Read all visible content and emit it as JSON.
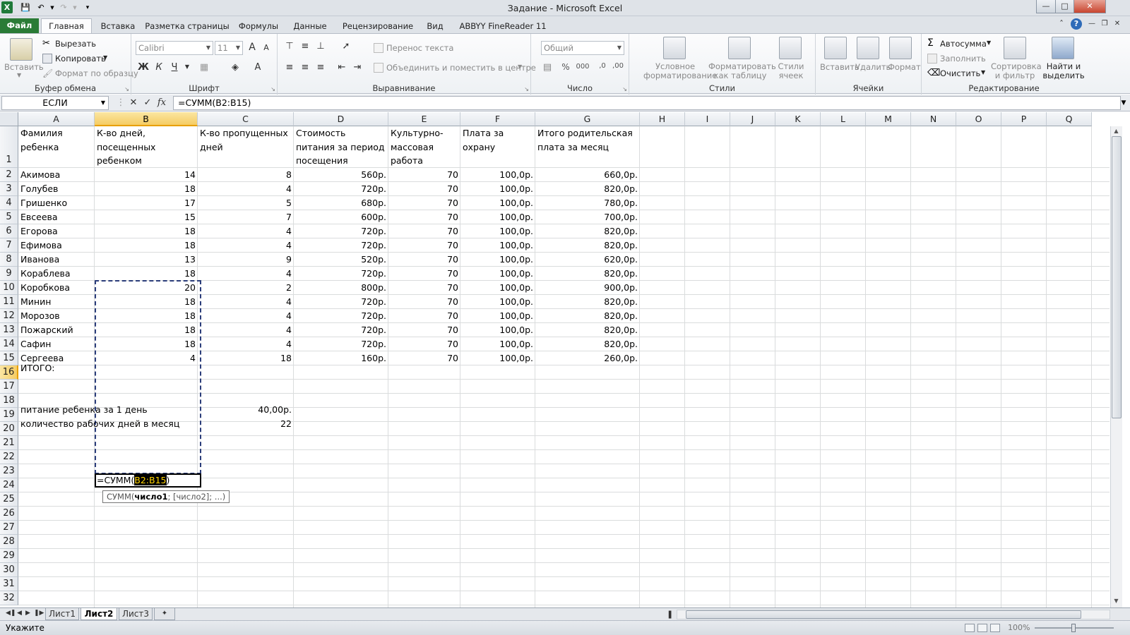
{
  "window": {
    "title": "Задание - Microsoft Excel"
  },
  "ribbon_tabs": [
    "Файл",
    "Главная",
    "Вставка",
    "Разметка страницы",
    "Формулы",
    "Данные",
    "Рецензирование",
    "Вид",
    "ABBYY FineReader 11"
  ],
  "clipboard": {
    "paste": "Вставить",
    "cut": "Вырезать",
    "copy": "Копировать",
    "format_painter": "Формат по образцу",
    "label": "Буфер обмена"
  },
  "font": {
    "name": "Calibri",
    "size": "11",
    "bold": "Ж",
    "italic": "К",
    "underline": "Ч",
    "grow": "A",
    "shrink": "A",
    "label": "Шрифт"
  },
  "alignment": {
    "wrap": "Перенос текста",
    "merge": "Объединить и поместить в центре",
    "label": "Выравнивание"
  },
  "number": {
    "format": "Общий",
    "percent": "%",
    "thousands": "000",
    "label": "Число"
  },
  "styles": {
    "conditional": "Условное форматирование",
    "table": "Форматировать как таблицу",
    "cell": "Стили ячеек",
    "label": "Стили"
  },
  "cells": {
    "insert": "Вставить",
    "delete": "Удалить",
    "format": "Формат",
    "label": "Ячейки"
  },
  "editing": {
    "autosum": "Автосумма",
    "fill": "Заполнить",
    "clear": "Очистить",
    "sort": "Сортировка и фильтр",
    "find": "Найти и выделить",
    "label": "Редактирование"
  },
  "formula_bar": {
    "name_box": "ЕСЛИ",
    "fx": "fx",
    "formula": "=СУММ(B2:B15)"
  },
  "columns": [
    "A",
    "B",
    "C",
    "D",
    "E",
    "F",
    "G",
    "H",
    "I",
    "J",
    "K",
    "L",
    "M",
    "N",
    "O",
    "P",
    "Q"
  ],
  "rows": [
    "1",
    "2",
    "3",
    "4",
    "5",
    "6",
    "7",
    "8",
    "9",
    "10",
    "11",
    "12",
    "13",
    "14",
    "15",
    "16",
    "17",
    "18",
    "19",
    "20",
    "21",
    "22",
    "23",
    "24",
    "25",
    "26",
    "27",
    "28",
    "29",
    "30",
    "31",
    "32"
  ],
  "headers": {
    "a": "Фамилия ребенка",
    "b": "К-во дней, посещенных ребенком",
    "c": "К-во пропущенных дней",
    "d": "Стоимость питания за период посещения",
    "e": "Культурно-массовая работа",
    "f": "Плата за охрану",
    "g": "Итого родительская плата за месяц"
  },
  "table": [
    {
      "name": "Акимова",
      "days": "14",
      "missed": "8",
      "food": "560р.",
      "culture": "70",
      "guard": "100,0р.",
      "total": "660,0р."
    },
    {
      "name": "Голубев",
      "days": "18",
      "missed": "4",
      "food": "720р.",
      "culture": "70",
      "guard": "100,0р.",
      "total": "820,0р."
    },
    {
      "name": "Гришенко",
      "days": "17",
      "missed": "5",
      "food": "680р.",
      "culture": "70",
      "guard": "100,0р.",
      "total": "780,0р."
    },
    {
      "name": "Евсеева",
      "days": "15",
      "missed": "7",
      "food": "600р.",
      "culture": "70",
      "guard": "100,0р.",
      "total": "700,0р."
    },
    {
      "name": "Егорова",
      "days": "18",
      "missed": "4",
      "food": "720р.",
      "culture": "70",
      "guard": "100,0р.",
      "total": "820,0р."
    },
    {
      "name": "Ефимова",
      "days": "18",
      "missed": "4",
      "food": "720р.",
      "culture": "70",
      "guard": "100,0р.",
      "total": "820,0р."
    },
    {
      "name": "Иванова",
      "days": "13",
      "missed": "9",
      "food": "520р.",
      "culture": "70",
      "guard": "100,0р.",
      "total": "620,0р."
    },
    {
      "name": "Кораблева",
      "days": "18",
      "missed": "4",
      "food": "720р.",
      "culture": "70",
      "guard": "100,0р.",
      "total": "820,0р."
    },
    {
      "name": "Коробкова",
      "days": "20",
      "missed": "2",
      "food": "800р.",
      "culture": "70",
      "guard": "100,0р.",
      "total": "900,0р."
    },
    {
      "name": "Минин",
      "days": "18",
      "missed": "4",
      "food": "720р.",
      "culture": "70",
      "guard": "100,0р.",
      "total": "820,0р."
    },
    {
      "name": "Морозов",
      "days": "18",
      "missed": "4",
      "food": "720р.",
      "culture": "70",
      "guard": "100,0р.",
      "total": "820,0р."
    },
    {
      "name": "Пожарский",
      "days": "18",
      "missed": "4",
      "food": "720р.",
      "culture": "70",
      "guard": "100,0р.",
      "total": "820,0р."
    },
    {
      "name": "Сафин",
      "days": "18",
      "missed": "4",
      "food": "720р.",
      "culture": "70",
      "guard": "100,0р.",
      "total": "820,0р."
    },
    {
      "name": "Сергеева",
      "days": "4",
      "missed": "18",
      "food": "160р.",
      "culture": "70",
      "guard": "100,0р.",
      "total": "260,0р."
    }
  ],
  "total_row": {
    "label": "ИТОГО:",
    "edit_prefix": "=СУММ(",
    "edit_ref": "B2:B15",
    "edit_suffix": ")"
  },
  "tooltip": {
    "fn": "СУММ(",
    "arg1": "число1",
    "rest": "; [число2]; ...)"
  },
  "extra": {
    "food_label": "питание ребенка за 1 день",
    "food_value": "40,00р.",
    "days_label": "количество рабочих дней в месяц",
    "days_value": "22"
  },
  "sheets": [
    "Лист1",
    "Лист2",
    "Лист3"
  ],
  "active_sheet": "Лист2",
  "status": {
    "mode": "Укажите",
    "zoom": "100%"
  }
}
